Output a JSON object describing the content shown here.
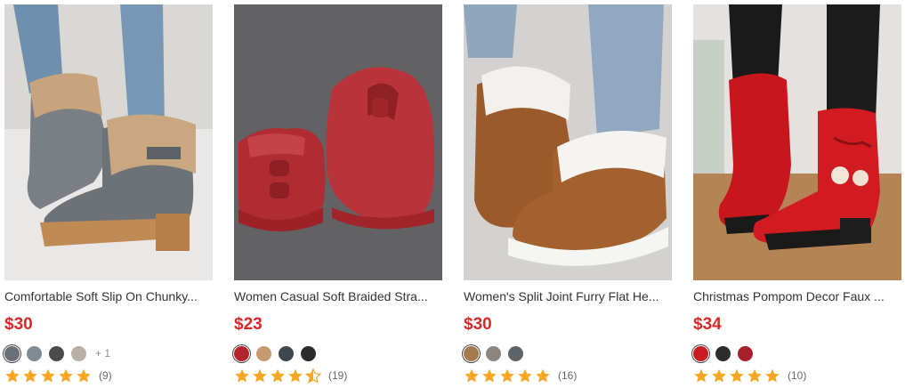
{
  "products": [
    {
      "title": "Comfortable Soft Slip On Chunky...",
      "price": "$30",
      "rating": 5,
      "review_count": "(9)",
      "more_swatches": "+ 1",
      "swatches": [
        "#6b7078",
        "#7f8a92",
        "#4d4a47",
        "#b9b0a8"
      ],
      "image_icon": "gray-fur-ankle-boot-photo"
    },
    {
      "title": "Women Casual Soft Braided Stra...",
      "price": "$23",
      "rating": 4.5,
      "review_count": "(19)",
      "more_swatches": "",
      "swatches": [
        "#b3242b",
        "#c59a70",
        "#3e4650",
        "#2a2a2a"
      ],
      "image_icon": "red-leather-ankle-boot-photo"
    },
    {
      "title": "Women's Split Joint Furry Flat He...",
      "price": "$30",
      "rating": 5,
      "review_count": "(16)",
      "more_swatches": "",
      "swatches": [
        "#a67a4f",
        "#8b8680",
        "#5f6469"
      ],
      "image_icon": "brown-furry-flat-shoe-photo"
    },
    {
      "title": "Christmas Pompom Decor Faux ...",
      "price": "$34",
      "rating": 5,
      "review_count": "(10)",
      "more_swatches": "",
      "swatches": [
        "#c91d22",
        "#2c2c2c",
        "#a8202a"
      ],
      "image_icon": "red-pompom-boot-photo"
    }
  ],
  "colors": {
    "price": "#d62a2a",
    "star": "#f5a623"
  }
}
